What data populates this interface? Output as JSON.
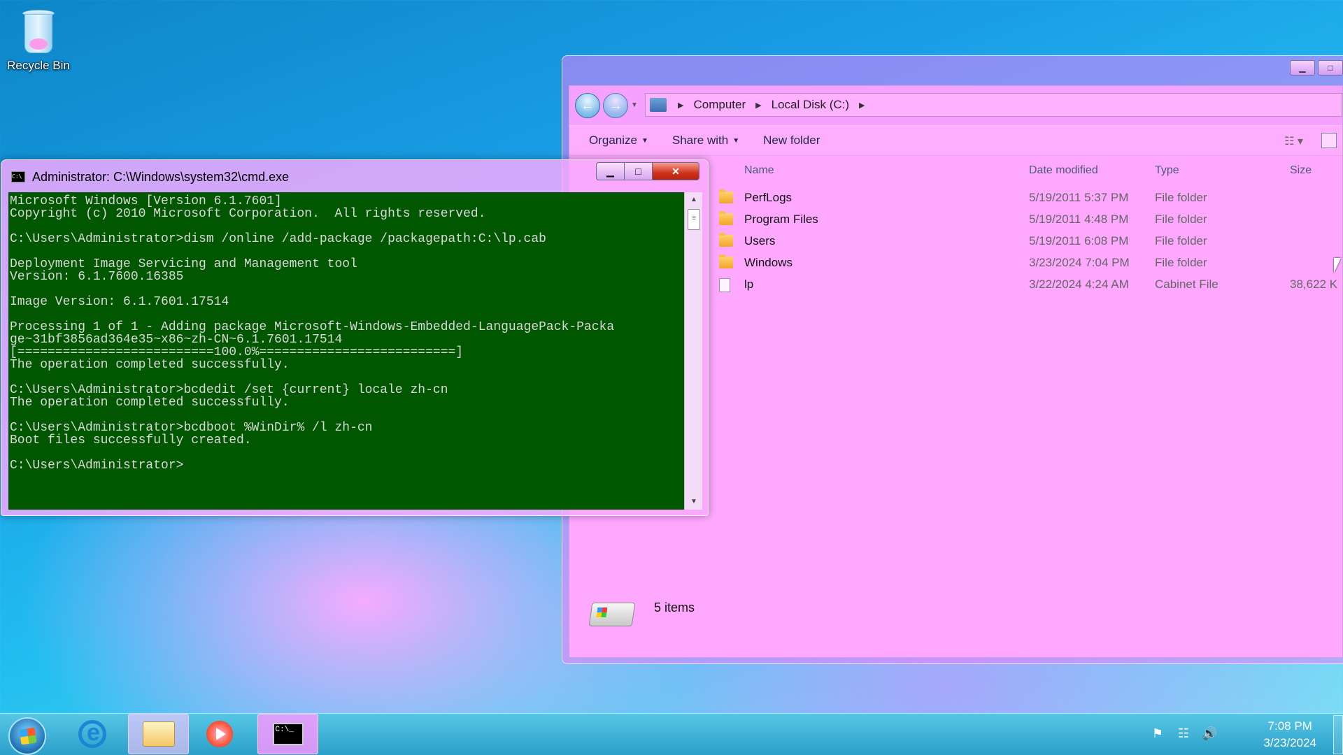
{
  "desktop": {
    "icons": [
      {
        "label": "Recycle Bin",
        "icon": "recycle-bin-icon"
      }
    ]
  },
  "explorer": {
    "breadcrumb": [
      "Computer",
      "Local Disk (C:)"
    ],
    "toolbar": {
      "organize": "Organize",
      "share_with": "Share with",
      "new_folder": "New folder"
    },
    "columns": {
      "name": "Name",
      "date": "Date modified",
      "type": "Type",
      "size": "Size"
    },
    "files": [
      {
        "name": "PerfLogs",
        "date": "5/19/2011 5:37 PM",
        "type": "File folder",
        "size": "",
        "icon": "folder-icon"
      },
      {
        "name": "Program Files",
        "date": "5/19/2011 4:48 PM",
        "type": "File folder",
        "size": "",
        "icon": "folder-icon"
      },
      {
        "name": "Users",
        "date": "5/19/2011 6:08 PM",
        "type": "File folder",
        "size": "",
        "icon": "folder-icon"
      },
      {
        "name": "Windows",
        "date": "3/23/2024 7:04 PM",
        "type": "File folder",
        "size": "",
        "icon": "folder-icon"
      },
      {
        "name": "lp",
        "date": "3/22/2024 4:24 AM",
        "type": "Cabinet File",
        "size": "38,622 K",
        "icon": "cabinet-file-icon"
      }
    ],
    "status": {
      "item_count": "5 items"
    }
  },
  "cmd": {
    "title": "Administrator: C:\\Windows\\system32\\cmd.exe",
    "output": "Microsoft Windows [Version 6.1.7601]\nCopyright (c) 2010 Microsoft Corporation.  All rights reserved.\n\nC:\\Users\\Administrator>dism /online /add-package /packagepath:C:\\lp.cab\n\nDeployment Image Servicing and Management tool\nVersion: 6.1.7600.16385\n\nImage Version: 6.1.7601.17514\n\nProcessing 1 of 1 - Adding package Microsoft-Windows-Embedded-LanguagePack-Packa\nge~31bf3856ad364e35~x86~zh-CN~6.1.7601.17514\n[==========================100.0%==========================]\nThe operation completed successfully.\n\nC:\\Users\\Administrator>bcdedit /set {current} locale zh-cn\nThe operation completed successfully.\n\nC:\\Users\\Administrator>bcdboot %WinDir% /l zh-cn\nBoot files successfully created.\n\nC:\\Users\\Administrator>"
  },
  "taskbar": {
    "pinned": [
      "start-orb",
      "internet-explorer-icon",
      "windows-explorer-icon",
      "media-player-icon",
      "command-prompt-icon"
    ],
    "cmd_icon_text": "C:\\_",
    "clock": {
      "time": "7:08 PM",
      "date": "3/23/2024"
    },
    "tray_icons": [
      "action-center-flag-icon",
      "network-icon",
      "volume-icon"
    ]
  }
}
